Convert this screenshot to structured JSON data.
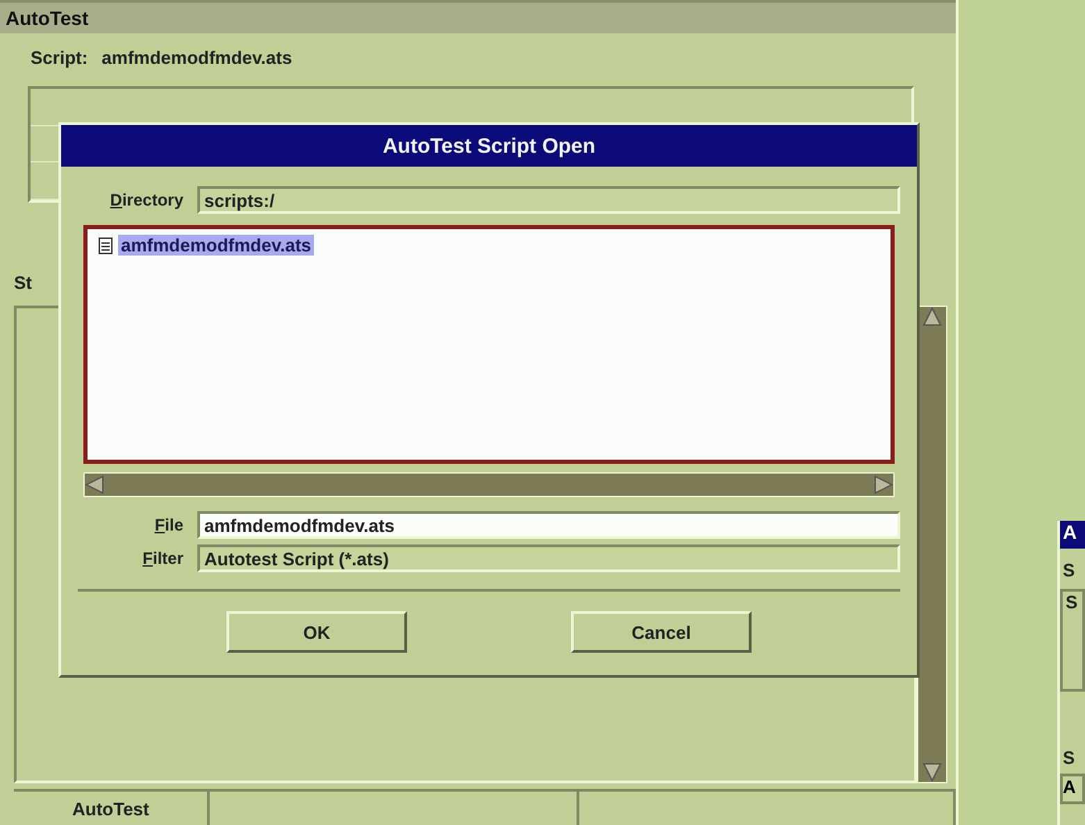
{
  "window": {
    "title": "AutoTest"
  },
  "script": {
    "label": "Script:",
    "value": "amfmdemodfmdev.ats"
  },
  "section_label": "St",
  "status_bar": {
    "title": "AutoTest"
  },
  "dialog": {
    "title": "AutoTest Script Open",
    "directory": {
      "label": "Directory",
      "value": "scripts:/"
    },
    "files": [
      {
        "name": "amfmdemodfmdev.ats",
        "selected": true
      }
    ],
    "file": {
      "label": "File",
      "value": "amfmdemodfmdev.ats"
    },
    "filter": {
      "label": "Filter",
      "value": "Autotest Script (*.ats)"
    },
    "buttons": [
      "OK",
      "Cancel"
    ]
  },
  "second_window": {
    "title": "A",
    "labels": [
      "S",
      "S"
    ],
    "table_header": "S",
    "field": "A"
  }
}
